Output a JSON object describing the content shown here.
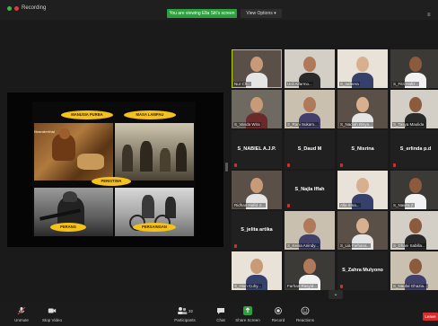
{
  "topbar": {
    "recording_label": "Recording",
    "sharing_banner": "You are viewing Ella Siti's screen",
    "view_options": "View Options",
    "view_options_caret": "▾",
    "layout_icon": "≡"
  },
  "slide": {
    "labels": [
      "MANUSIA PURBA",
      "MASA LAMPAU",
      "PERISTIWA",
      "PERANG",
      "PERSAINGAN"
    ],
    "corner_text": "Neanderthal"
  },
  "gallery": {
    "tiles": [
      {
        "name": "Nur Ch...",
        "kind": "video",
        "active": true
      },
      {
        "name": "Ucil Aifarmo...",
        "kind": "video"
      },
      {
        "name": "S_nafeera",
        "kind": "video"
      },
      {
        "name": "S_Fitri Hafiz...",
        "kind": "video"
      },
      {
        "name": "S_Vanda Wira",
        "kind": "video"
      },
      {
        "name": "S_Rani Sukam...",
        "kind": "video"
      },
      {
        "name": "S_Nadiah Bisya...",
        "kind": "video"
      },
      {
        "name": "S_Tasya Maulida",
        "kind": "video"
      },
      {
        "name": "S_NABIEL A.J.P.",
        "kind": "name"
      },
      {
        "name": "S_Daud M",
        "kind": "name"
      },
      {
        "name": "S_Nisrina",
        "kind": "name"
      },
      {
        "name": "S_erlinda p.d",
        "kind": "name"
      },
      {
        "name": "Ridhan Hafid Ji...",
        "kind": "video"
      },
      {
        "name": "S_Najla Iffah",
        "kind": "name"
      },
      {
        "name": "Alla Irma...",
        "kind": "video"
      },
      {
        "name": "S_Nawra Z",
        "kind": "video"
      },
      {
        "name": "S_jelita artika",
        "kind": "name"
      },
      {
        "name": "S_Keisa Anindy...",
        "kind": "video"
      },
      {
        "name": "S_Lia Farhana...",
        "kind": "video"
      },
      {
        "name": "S_Dhani Sabilla...",
        "kind": "video"
      },
      {
        "name": "S_Hiun Cuhy...",
        "kind": "video"
      },
      {
        "name": "Farhan Rasyid...",
        "kind": "video"
      },
      {
        "name": "S_Zahra Mulyono",
        "kind": "name"
      },
      {
        "name": "S_Naufal Ghazia...",
        "kind": "video"
      }
    ],
    "collapse_icon": "⌄"
  },
  "toolbar": {
    "unmute": "Unmute",
    "stop_video": "Stop Video",
    "participants": "Participants",
    "participants_count": "32",
    "chat": "Chat",
    "share_screen": "Share Screen",
    "record": "Record",
    "reactions": "Reactions",
    "leave": "Leave"
  },
  "colors": {
    "banner_green": "#2e9e3e",
    "active_outline": "#b8d300",
    "leave_red": "#d32d2d",
    "label_yellow": "#f4c21a"
  }
}
